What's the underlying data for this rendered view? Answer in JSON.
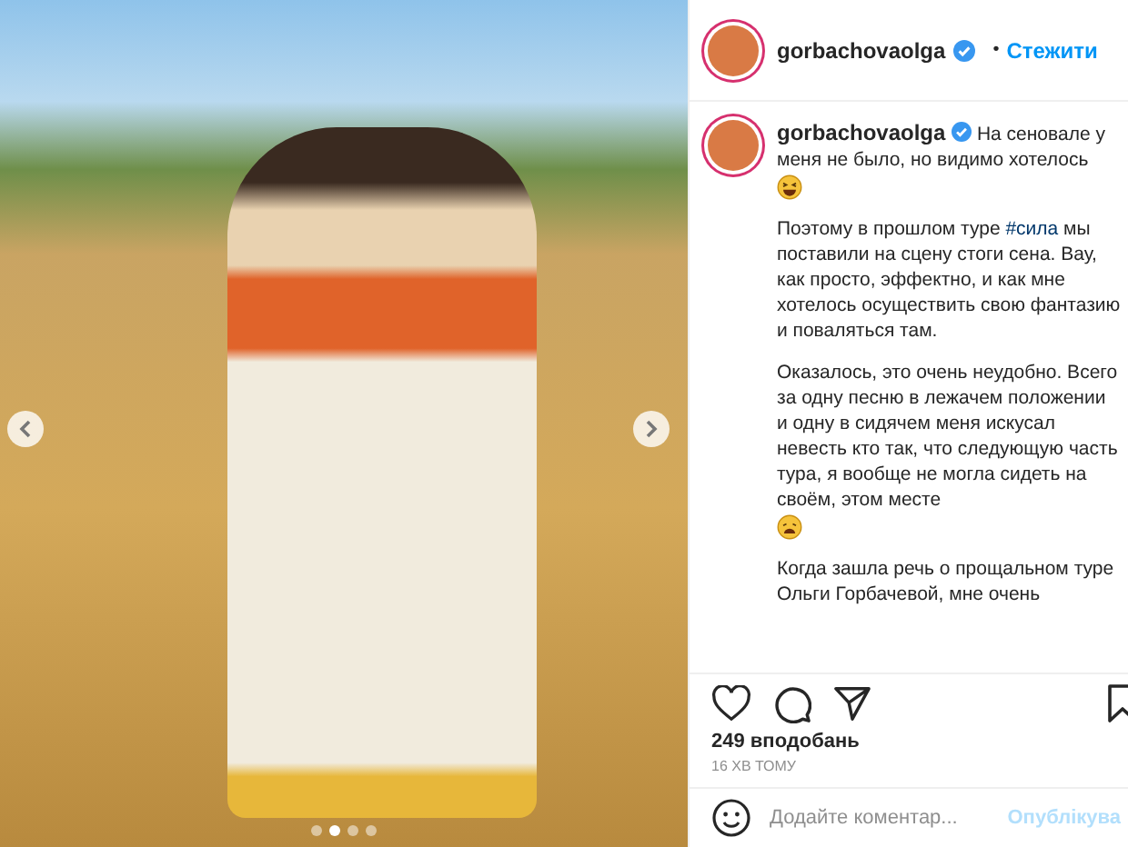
{
  "photo": {
    "carousel": {
      "dots": [
        {
          "selected": false
        },
        {
          "selected": true
        },
        {
          "selected": false
        },
        {
          "selected": false
        }
      ]
    }
  },
  "header": {
    "username": "gorbachovaolga",
    "verified": true,
    "separator": "•",
    "follow": "Стежити"
  },
  "caption": {
    "username": "gorbachovaolga",
    "verified": true,
    "paragraphs": [
      {
        "parts": [
          {
            "kind": "text",
            "text": "На сеновале у меня не было, но видимо хотелось"
          },
          {
            "kind": "laughing_emoji"
          }
        ]
      },
      {
        "parts": [
          {
            "kind": "text",
            "text": "Поэтому в прошлом туре "
          },
          {
            "kind": "hashtag",
            "text": "#сила"
          },
          {
            "kind": "text",
            "text": " мы поставили на сцену стоги сена. Вау, как просто, эффектно, и как мне хотелось осуществить свою фантазию и поваляться там."
          }
        ]
      },
      {
        "parts": [
          {
            "kind": "text",
            "text": "Оказалось, это очень неудобно. Всего за одну песню в лежачем положении и одну в сидячем меня искусал невесть кто так, что следующую часть тура, я вообще не могла сидеть на своём, этом месте"
          },
          {
            "kind": "weary_emoji"
          }
        ]
      },
      {
        "parts": [
          {
            "kind": "text",
            "text": "Когда зашла речь о прощальном туре Ольги Горбачевой, мне очень"
          }
        ]
      }
    ]
  },
  "likes": "249 вподобань",
  "time": "16 ХВ ТОМУ",
  "comment": {
    "placeholder": "Додайте коментар...",
    "post_button": "Опублікува",
    "disabled": true
  }
}
